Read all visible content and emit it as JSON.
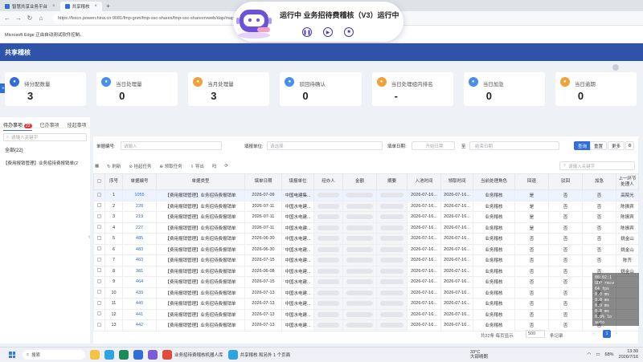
{
  "browser": {
    "tabs": [
      {
        "label": "智慧共享业务平台"
      },
      {
        "label": "共享稽核"
      }
    ],
    "url": "https://fsscn.powerchina.cn:9081/fmp-gnm/fmp-ssc-shares/fmp-ssc-sharesrvweb/dap/mapp/sharesrvweb/page/dist",
    "infobar": "Microsoft Edge 正由自动测试软件控制。"
  },
  "recorder": {
    "title": "运行中 业务招待费稽核（V3）运行中",
    "controls": [
      "pause",
      "resume",
      "stop"
    ]
  },
  "app": {
    "title": "共享稽核"
  },
  "stats": [
    {
      "label": "待分配数量",
      "value": "3",
      "icon": "user-icon",
      "color": "#2f6fd6"
    },
    {
      "label": "当日处理量",
      "value": "0",
      "icon": "user-icon",
      "color": "#4a8fe7"
    },
    {
      "label": "当月处理量",
      "value": "3",
      "icon": "user-icon",
      "color": "#f0a23a"
    },
    {
      "label": "驳回待确认",
      "value": "0",
      "icon": "user-icon",
      "color": "#4a8fe7"
    },
    {
      "label": "当日处理组内排名",
      "value": "-",
      "icon": "user-icon",
      "color": "#f0a23a"
    },
    {
      "label": "当日加急",
      "value": "0",
      "icon": "user-icon",
      "color": "#4a8fe7"
    },
    {
      "label": "当日逾期",
      "value": "0",
      "icon": "user-icon",
      "color": "#f0a23a"
    }
  ],
  "left": {
    "tabs": [
      {
        "label": "待办事项",
        "badge": "22"
      },
      {
        "label": "已办事项"
      },
      {
        "label": "挂起事项"
      }
    ],
    "search_placeholder": "请输入关键字",
    "all_label": "全部(22)",
    "items": [
      "【费用报销管理】业务招待费报销单(2"
    ]
  },
  "filter": {
    "doc_no_label": "单据编号:",
    "doc_no_placeholder": "请输入",
    "unit_label": "填报单位:",
    "unit_placeholder": "请选择",
    "date_label": "填单日期:",
    "start_placeholder": "开始日期",
    "to_label": "至",
    "end_placeholder": "结束日期",
    "query": "查询",
    "reset": "重置",
    "more": "更多"
  },
  "toolbar": {
    "refresh": "刷新",
    "suspend": "挂起任务",
    "claim": "领取任务",
    "export": "导出",
    "extra": "吗",
    "search_placeholder": "请输入关键字"
  },
  "table": {
    "headers": [
      "",
      "序号",
      "单据编号",
      "单据类型",
      "填单日期",
      "填报单位",
      "经办人",
      "金额",
      "摘要",
      "入池时间",
      "领取时间",
      "当前处理角色",
      "回退",
      "驳回",
      "加急",
      "上一环节处理人"
    ],
    "rows": [
      [
        "1",
        "1055",
        "【费用报销管理】业务招待费报销单",
        "2026-07-09",
        "中国电建集...",
        "2026-07-16...",
        "2026-07-16...",
        "业务稽核",
        "是",
        "否",
        "否",
        "高院光"
      ],
      [
        "2",
        "228",
        "【费用报销管理】业务招待费报销单",
        "2026-07-11",
        "中国水电建...",
        "2026-07-16...",
        "2026-07-16...",
        "业务稽核",
        "是",
        "否",
        "否",
        "陈振宾"
      ],
      [
        "3",
        "219",
        "【费用报销管理】业务招待费报销单",
        "2026-07-11",
        "中国水电建...",
        "2026-07-16...",
        "2026-07-16...",
        "业务稽核",
        "是",
        "否",
        "否",
        "陈振宾"
      ],
      [
        "4",
        "227",
        "【费用报销管理】业务招待费报销单",
        "2026-07-11",
        "中国水电建...",
        "2026-07-16...",
        "2026-07-16...",
        "业务稽核",
        "是",
        "否",
        "否",
        "陈振宾"
      ],
      [
        "5",
        "485",
        "【费用报销管理】业务招待费报销单",
        "2026-06-30",
        "中国水电建...",
        "2026-07-16...",
        "2026-07-16...",
        "业务稽核",
        "否",
        "否",
        "否",
        "姚金山"
      ],
      [
        "6",
        "483",
        "【费用报销管理】业务招待费报销单",
        "2026-06-30",
        "中国水电建...",
        "2026-07-16...",
        "2026-07-16...",
        "业务稽核",
        "否",
        "否",
        "否",
        "姚金山"
      ],
      [
        "7",
        "463",
        "【费用报销管理】业务招待费报销单",
        "2026-07-15",
        "中国水电建...",
        "2026-07-16...",
        "2026-07-16...",
        "业务稽核",
        "否",
        "否",
        "否",
        "陈齐"
      ],
      [
        "8",
        "381",
        "【费用报销管理】业务招待费报销单",
        "2026-06-08",
        "中国水电建...",
        "2026-07-16...",
        "2026-07-16...",
        "业务稽核",
        "否",
        "否",
        "否",
        "姚金山"
      ],
      [
        "9",
        "464",
        "【费用报销管理】业务招待费报销单",
        "2026-07-15",
        "中国水电建...",
        "2026-07-16...",
        "2026-07-16...",
        "业务稽核",
        "否",
        "否",
        "否",
        ""
      ],
      [
        "10",
        "439",
        "【费用报销管理】业务招待费报销单",
        "2026-07-13",
        "中国水电建...",
        "2026-07-16...",
        "2026-07-16...",
        "业务稽核",
        "否",
        "否",
        "否",
        ""
      ],
      [
        "11",
        "440",
        "【费用报销管理】业务招待费报销单",
        "2026-07-13",
        "中国水电建...",
        "2026-07-16...",
        "2026-07-16...",
        "业务稽核",
        "否",
        "否",
        "否",
        ""
      ],
      [
        "12",
        "441",
        "【费用报销管理】业务招待费报销单",
        "2026-07-13",
        "中国水电建...",
        "2026-07-16...",
        "2026-07-16...",
        "业务稽核",
        "否",
        "否",
        "否",
        ""
      ],
      [
        "13",
        "442",
        "【费用报销管理】业务招待费报销单",
        "2026-07-13",
        "中国水电建...",
        "2026-07-16...",
        "2026-07-16...",
        "业务稽核",
        "否",
        "否",
        "否",
        ""
      ]
    ]
  },
  "pager": {
    "total": "共22条 每页显示",
    "page_size": "500",
    "page_unit": "条记录",
    "current": "1"
  },
  "overlay": {
    "lines": [
      "00:02:1",
      "UDP recv",
      "64 fps",
      "0.0 ms",
      "0.0 ms",
      "0.0 ms",
      "0.0 ms",
      "0.0% lo",
      "auto"
    ]
  },
  "taskbar": {
    "search": "搜索",
    "app1": "业务招待费稽核机器人库",
    "app2": "共享稽核 和另外 1 个页面",
    "weather_temp": "33°C",
    "weather_desc": "大部晴朗",
    "battery": "68%",
    "time": "13:30",
    "date": "2026/7/16"
  }
}
